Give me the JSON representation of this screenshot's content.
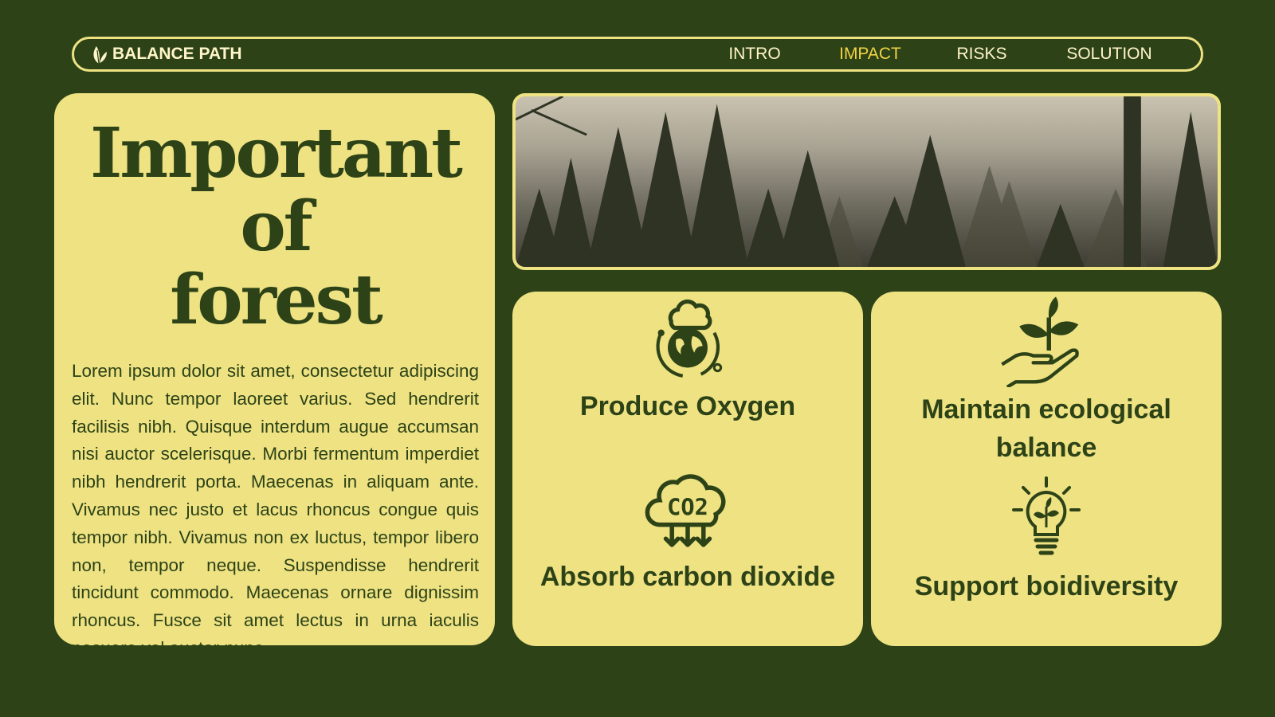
{
  "header": {
    "brand": "BALANCE PATH",
    "brand_icon": "leaf-icon",
    "nav": [
      {
        "label": "INTRO",
        "active": false
      },
      {
        "label": "IMPACT",
        "active": true
      },
      {
        "label": "RISKS",
        "active": false
      },
      {
        "label": "SOLUTION",
        "active": false
      }
    ]
  },
  "main": {
    "title_line1": "Important of",
    "title_line2": "forest",
    "body": "Lorem ipsum dolor sit amet, consectetur adipiscing elit. Nunc tempor laoreet varius. Sed hendrerit facilisis nibh. Quisque interdum augue accumsan nisi auctor scelerisque. Morbi fermentum imperdiet nibh hendrerit porta. Maecenas in aliquam ante. Vivamus nec justo et lacus rhoncus congue quis tempor nibh. Vivamus non ex luctus, tempor libero non, tempor neque. Suspendisse hendrerit tincidunt commodo. Maecenas ornare dignissim rhoncus. Fusce sit amet lectus in urna iaculis posuere vel auctor nunc."
  },
  "benefits": [
    {
      "label": "Produce Oxygen",
      "icon": "earth-cloud-icon"
    },
    {
      "label": "Absorb carbon dioxide",
      "icon": "co2-cloud-icon",
      "icon_text": "CO2"
    },
    {
      "label": "Maintain ecological balance",
      "icon": "hand-plant-icon"
    },
    {
      "label": "Support boidiversity",
      "icon": "lightbulb-plant-icon"
    }
  ],
  "colors": {
    "background": "#2d4317",
    "panel": "#eee283",
    "nav_text": "#fff5c8",
    "active": "#f1d344",
    "text": "#2d4317"
  }
}
